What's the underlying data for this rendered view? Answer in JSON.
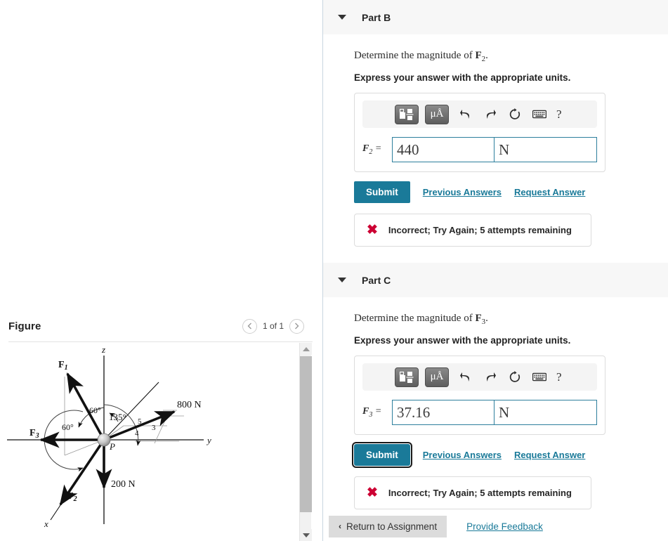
{
  "figure_panel": {
    "title": "Figure",
    "pager": {
      "prev_icon": "chevron-left-icon",
      "next_icon": "chevron-right-icon",
      "count_text": "1 of 1"
    },
    "diagram": {
      "axes": [
        "z",
        "y",
        "x"
      ],
      "origin_label": "P",
      "vectors": [
        {
          "name": "F1",
          "label": "F",
          "sub": "1"
        },
        {
          "name": "F2",
          "label": "F",
          "sub": "2"
        },
        {
          "name": "F3",
          "label": "F",
          "sub": "3"
        }
      ],
      "magnitudes": [
        "800 N",
        "200 N"
      ],
      "angles": [
        "60°",
        "135°",
        "60°"
      ],
      "triangle_labels": [
        "5",
        "4",
        "3"
      ]
    }
  },
  "parts": [
    {
      "id": "part-b",
      "header": "Part B",
      "prompt_prefix": "Determine the magnitude of ",
      "prompt_vector": "F",
      "prompt_sub": "2",
      "prompt_suffix": ".",
      "instruction": "Express your answer with the appropriate units.",
      "toolbar": {
        "template_icon": "math-template-icon",
        "units_icon": "micro-angstrom-units-icon",
        "units_text": "μÅ",
        "undo_icon": "undo-icon",
        "redo_icon": "redo-icon",
        "reset_icon": "reset-icon",
        "keyboard_icon": "keyboard-icon",
        "help_icon": "help-icon",
        "help_text": "?"
      },
      "answer": {
        "label_var": "F",
        "label_sub": "2",
        "label_eq": " = ",
        "value": "440",
        "units": "N",
        "value_placeholder": "",
        "units_placeholder": ""
      },
      "submit_label": "Submit",
      "submit_focused": false,
      "previous_answers_label": "Previous Answers",
      "request_answer_label": "Request Answer",
      "feedback": {
        "icon": "x-mark-icon",
        "glyph": "✖",
        "text": "Incorrect; Try Again; 5 attempts remaining"
      }
    },
    {
      "id": "part-c",
      "header": "Part C",
      "prompt_prefix": "Determine the magnitude of ",
      "prompt_vector": "F",
      "prompt_sub": "3",
      "prompt_suffix": ".",
      "instruction": "Express your answer with the appropriate units.",
      "toolbar": {
        "template_icon": "math-template-icon",
        "units_icon": "micro-angstrom-units-icon",
        "units_text": "μÅ",
        "undo_icon": "undo-icon",
        "redo_icon": "redo-icon",
        "reset_icon": "reset-icon",
        "keyboard_icon": "keyboard-icon",
        "help_icon": "help-icon",
        "help_text": "?"
      },
      "answer": {
        "label_var": "F",
        "label_sub": "3",
        "label_eq": " = ",
        "value": "37.16",
        "units": "N",
        "value_placeholder": "",
        "units_placeholder": ""
      },
      "submit_label": "Submit",
      "submit_focused": true,
      "previous_answers_label": "Previous Answers",
      "request_answer_label": "Request Answer",
      "feedback": {
        "icon": "x-mark-icon",
        "glyph": "✖",
        "text": "Incorrect; Try Again; 5 attempts remaining"
      }
    }
  ],
  "bottom_nav": {
    "return_label": "Return to Assignment",
    "return_chevron": "‹",
    "feedback_label": "Provide Feedback"
  },
  "colors": {
    "accent_teal": "#1a7a99",
    "error_red": "#cc0033",
    "header_bg": "#f7f7f7",
    "toolbar_bg": "#f4f4f4"
  }
}
